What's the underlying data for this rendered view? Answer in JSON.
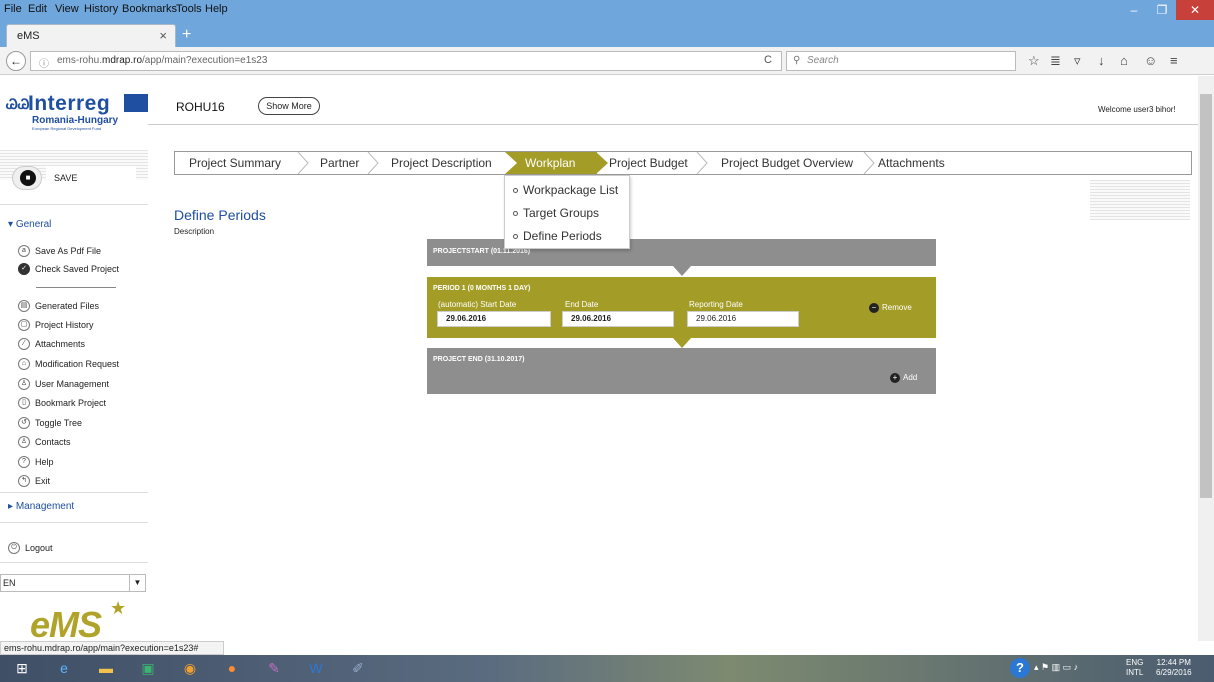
{
  "browser": {
    "menu": [
      "File",
      "Edit",
      "View",
      "History",
      "Bookmarks",
      "Tools",
      "Help"
    ],
    "tab_title": "eMS",
    "tab_close": "×",
    "new_tab": "+",
    "url_host": "ems-rohu.",
    "url_bold": "mdrap.ro",
    "url_path": "/app/main?execution=e1s23",
    "search_placeholder": "Search",
    "status_url": "ems-rohu.mdrap.ro/app/main?execution=e1s23#"
  },
  "logo": {
    "name": "Interreg",
    "region": "Romania-Hungary",
    "fund": "European Regional Development Fund"
  },
  "header": {
    "project_code": "ROHU16",
    "show_more": "Show More",
    "welcome": "Welcome user3 bihor!"
  },
  "sidebar": {
    "save_label": "SAVE",
    "general_label": "General",
    "items_top": [
      {
        "label": "Save As Pdf File",
        "icon": "lock-icon"
      },
      {
        "label": "Check Saved Project",
        "icon": "check-icon"
      }
    ],
    "items": [
      {
        "label": "Generated Files",
        "icon": "files-icon"
      },
      {
        "label": "Project History",
        "icon": "history-icon"
      },
      {
        "label": "Attachments",
        "icon": "paperclip-icon"
      },
      {
        "label": "Modification Request",
        "icon": "building-icon"
      },
      {
        "label": "User Management",
        "icon": "user-icon"
      },
      {
        "label": "Bookmark Project",
        "icon": "bookmark-icon"
      },
      {
        "label": "Toggle Tree",
        "icon": "toggle-icon"
      },
      {
        "label": "Contacts",
        "icon": "contacts-icon"
      },
      {
        "label": "Help",
        "icon": "help-icon"
      },
      {
        "label": "Exit",
        "icon": "exit-icon"
      }
    ],
    "management_label": "Management",
    "logout_label": "Logout",
    "language": "EN",
    "ems_logo": "eMS"
  },
  "crumbs": [
    {
      "label": "Project Summary",
      "active": false
    },
    {
      "label": "Partner",
      "active": false
    },
    {
      "label": "Project Description",
      "active": false
    },
    {
      "label": "Workplan",
      "active": true
    },
    {
      "label": "Project Budget",
      "active": false
    },
    {
      "label": "Project Budget Overview",
      "active": false
    },
    {
      "label": "Attachments",
      "active": false
    }
  ],
  "dropdown": [
    "Workpackage List",
    "Target Groups",
    "Define Periods"
  ],
  "content": {
    "title": "Define Periods",
    "description": "Description",
    "project_start": "PROJECTSTART (01.11.2016)",
    "period_title": "PERIOD 1 (0 MONTHS 1 DAY)",
    "start_label": "(automatic) Start Date",
    "start_value": "29.06.2016",
    "end_label": "End Date",
    "end_value": "29.06.2016",
    "reporting_label": "Reporting Date",
    "reporting_value": "29.06.2016",
    "remove_label": "Remove",
    "project_end": "PROJECT END (31.10.2017)",
    "add_label": "Add"
  },
  "taskbar": {
    "lang": "ENG",
    "lang2": "INTL",
    "time": "12:44 PM",
    "date": "6/29/2016"
  },
  "colors": {
    "accent_olive": "#a39c27",
    "grey_panel": "#8e8e8e",
    "brand_blue": "#1f4fa0",
    "title_bar": "#6fa6dc"
  }
}
